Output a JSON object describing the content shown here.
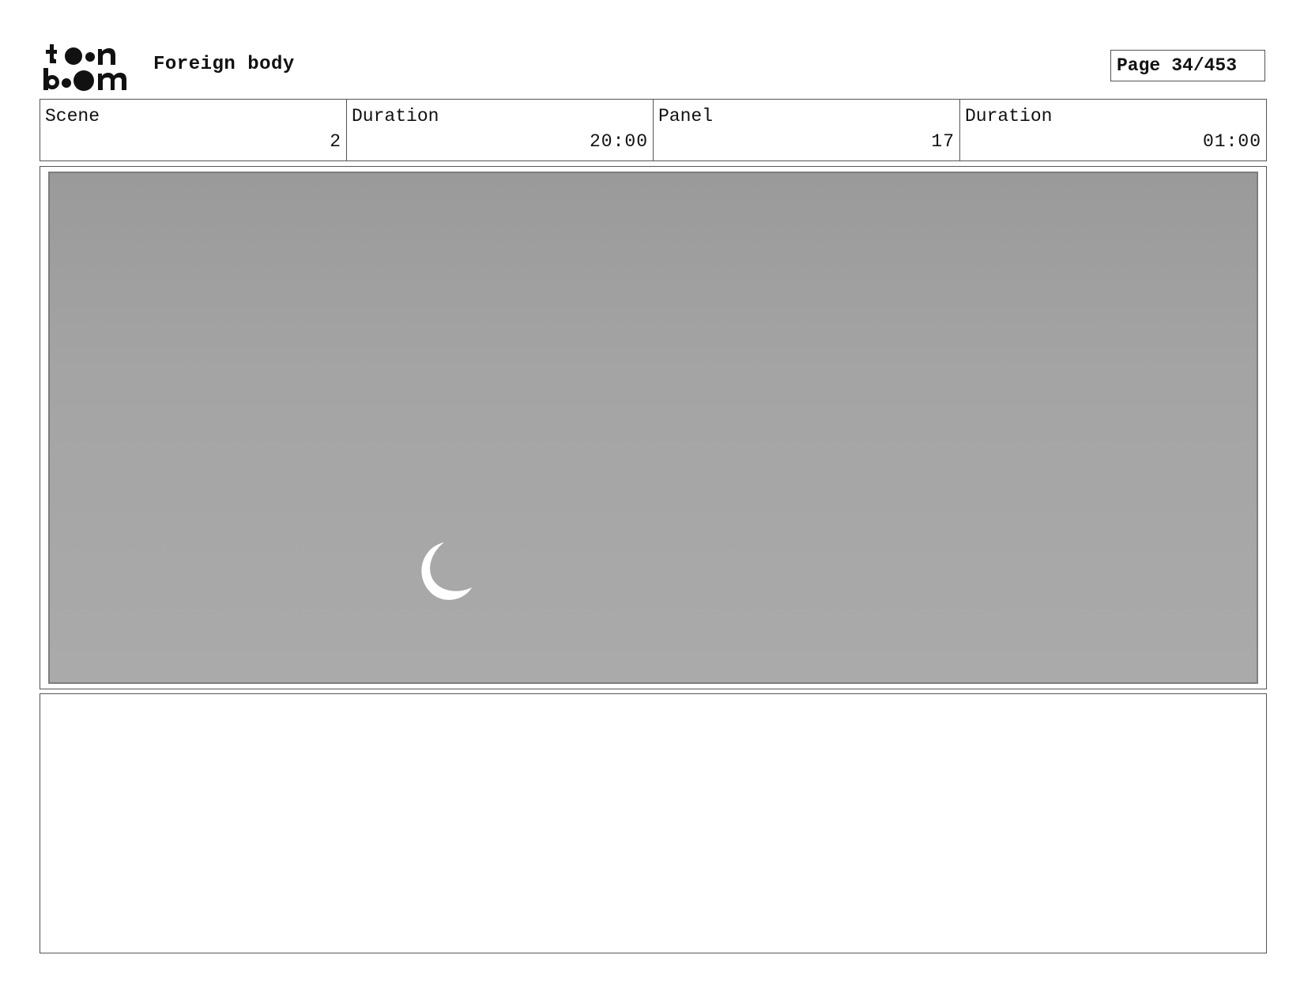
{
  "header": {
    "logo_text": "toon boom",
    "project_title": "Foreign body",
    "page_label": "Page",
    "page_number": "34/453"
  },
  "info": {
    "scene_label": "Scene",
    "scene_value": "2",
    "scene_duration_label": "Duration",
    "scene_duration_value": "20:00",
    "panel_label": "Panel",
    "panel_value": "17",
    "panel_duration_label": "Duration",
    "panel_duration_value": "01:00"
  },
  "panel": {
    "background_color": "#a4a4a4",
    "moon_color": "#ffffff",
    "icon": "crescent-moon-icon"
  },
  "notes": {
    "text": ""
  }
}
